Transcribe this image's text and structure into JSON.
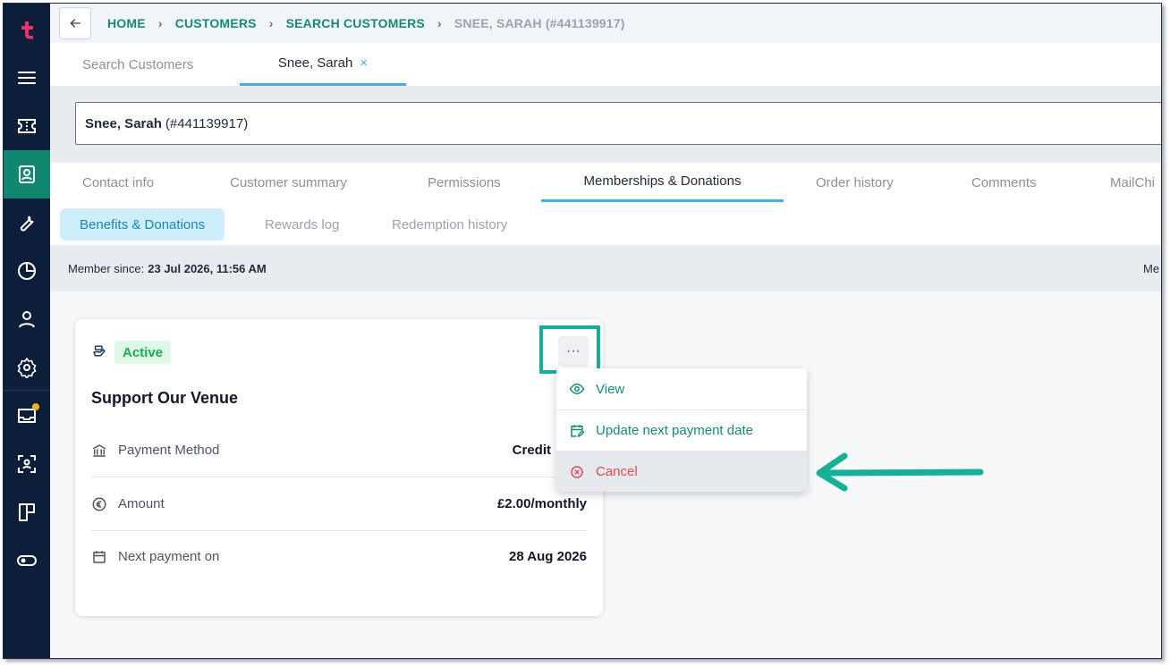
{
  "breadcrumb": {
    "items": [
      "HOME",
      "CUSTOMERS",
      "SEARCH CUSTOMERS"
    ],
    "current": "SNEE, SARAH (#441139917)"
  },
  "page_tabs": [
    {
      "label": "Search Customers"
    },
    {
      "label": "Snee, Sarah",
      "close": "×"
    }
  ],
  "customer_field": {
    "name": "Snee, Sarah",
    "id": "(#441139917)"
  },
  "section_tabs": [
    "Contact info",
    "Customer summary",
    "Permissions",
    "Memberships & Donations",
    "Order history",
    "Comments",
    "MailChi"
  ],
  "sub_tabs": [
    "Benefits & Donations",
    "Rewards log",
    "Redemption history"
  ],
  "member_bar": {
    "label": "Member since:",
    "value": "23 Jul 2026, 11:56 AM",
    "right_fragment": "Me"
  },
  "card": {
    "status": "Active",
    "title": "Support Our Venue",
    "more": "···",
    "rows": [
      {
        "label": "Payment Method",
        "value": "Credit"
      },
      {
        "label": "Amount",
        "value": "£2.00/monthly"
      },
      {
        "label": "Next payment on",
        "value": "28 Aug 2026"
      }
    ]
  },
  "menu": {
    "items": [
      "View",
      "Update next payment date",
      "Cancel"
    ]
  },
  "colors": {
    "sidebar": "#0d1e3a",
    "accent": "#178a75",
    "tab_underline": "#3fb2df",
    "danger": "#e04b4b",
    "highlight": "#15b095"
  }
}
